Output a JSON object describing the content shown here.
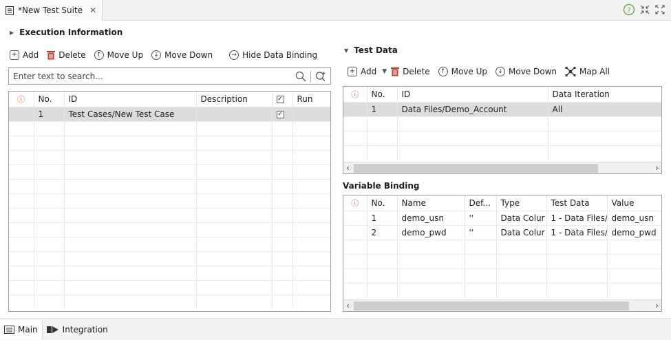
{
  "tab": {
    "title": "*New Test Suite"
  },
  "execution": {
    "title": "Execution Information",
    "toolbar": {
      "add": "Add",
      "delete": "Delete",
      "move_up": "Move Up",
      "move_down": "Move Down",
      "hide_binding": "Hide Data Binding"
    },
    "search_placeholder": "Enter text to search...",
    "columns": [
      "No.",
      "ID",
      "Description",
      "Run"
    ],
    "rows": [
      {
        "no": "1",
        "id": "Test Cases/New Test Case",
        "description": ""
      }
    ]
  },
  "test_data": {
    "title": "Test Data",
    "toolbar": {
      "add": "Add",
      "delete": "Delete",
      "move_up": "Move Up",
      "move_down": "Move Down",
      "map_all": "Map All"
    },
    "columns": [
      "No.",
      "ID",
      "Data Iteration"
    ],
    "rows": [
      {
        "no": "1",
        "id": "Data Files/Demo_Account",
        "iteration": "All"
      }
    ]
  },
  "variable_binding": {
    "title": "Variable Binding",
    "columns": [
      "No.",
      "Name",
      "Def...",
      "Type",
      "Test Data",
      "Value"
    ],
    "rows": [
      {
        "no": "1",
        "name": "demo_usn",
        "def": "''",
        "type": "Data Colur",
        "test_data": "1 - Data Files/",
        "value": "demo_usn"
      },
      {
        "no": "2",
        "name": "demo_pwd",
        "def": "''",
        "type": "Data Colur",
        "test_data": "1 - Data Files/",
        "value": "demo_pwd"
      }
    ]
  },
  "bottom_tabs": {
    "main": "Main",
    "integration": "Integration"
  },
  "colors": {
    "warning": "#d9532c",
    "help": "#6aa84f",
    "delete": "#c0392b",
    "selection": "#dcdcdc"
  }
}
